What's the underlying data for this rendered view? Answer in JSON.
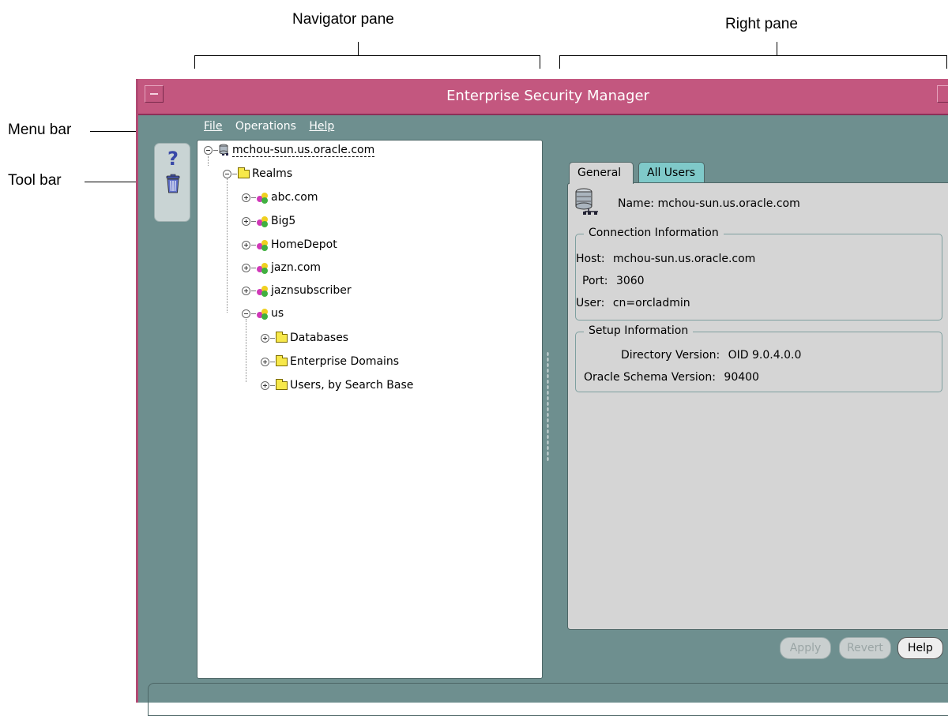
{
  "annotations": {
    "navigator_pane": "Navigator pane",
    "right_pane": "Right pane",
    "menu_bar": "Menu bar",
    "tool_bar": "Tool bar"
  },
  "window": {
    "title": "Enterprise Security Manager"
  },
  "menu": {
    "file": "File",
    "operations": "Operations",
    "help": "Help"
  },
  "toolbar": {
    "help_icon": "question-mark",
    "delete_icon": "trash-can"
  },
  "tree": {
    "root": "mchou-sun.us.oracle.com",
    "realms": "Realms",
    "realm_items": [
      "abc.com",
      "Big5",
      "HomeDepot",
      "jazn.com",
      "jaznsubscriber",
      "us"
    ],
    "us_children": [
      "Databases",
      "Enterprise Domains",
      "Users, by Search Base"
    ]
  },
  "tabs": {
    "general": "General",
    "all_users": "All Users"
  },
  "general": {
    "name_label": "Name:",
    "name_value": "mchou-sun.us.oracle.com",
    "connection": {
      "legend": "Connection Information",
      "host_label": "Host:",
      "host_value": "mchou-sun.us.oracle.com",
      "port_label": "Port:",
      "port_value": "3060",
      "user_label": "User:",
      "user_value": "cn=orcladmin"
    },
    "setup": {
      "legend": "Setup Information",
      "dir_label": "Directory Version:",
      "dir_value": "OID 9.0.4.0.0",
      "schema_label": "Oracle Schema Version:",
      "schema_value": "90400"
    }
  },
  "buttons": {
    "apply": "Apply",
    "revert": "Revert",
    "help": "Help"
  },
  "colors": {
    "title_bar": "#c3577f",
    "desktop": "#6e8f8f",
    "panel": "#d5d5d5",
    "tab_inactive": "#7fc9c9"
  }
}
